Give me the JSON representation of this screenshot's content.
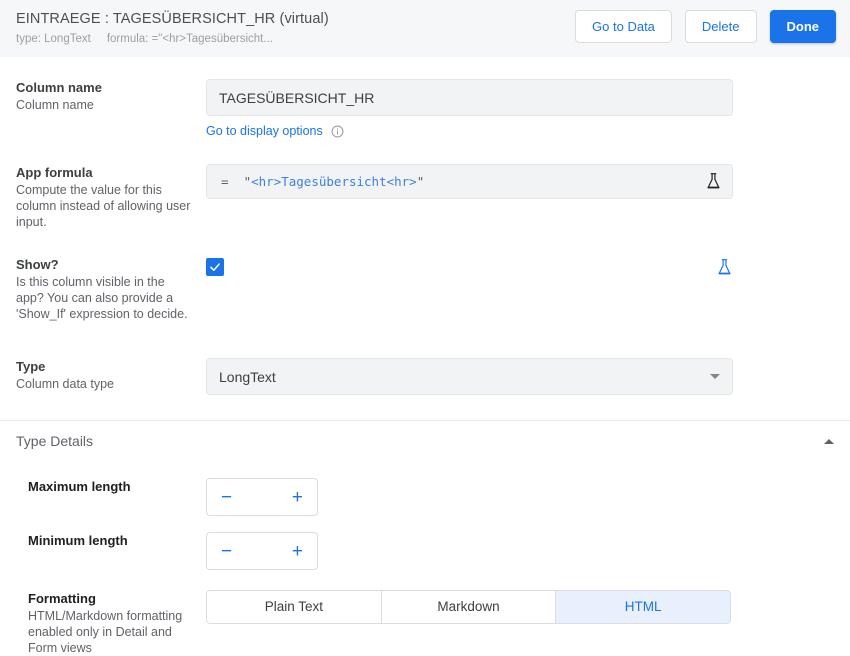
{
  "header": {
    "title": "EINTRAEGE : TAGESÜBERSICHT_HR (virtual)",
    "type_label": "type: LongText",
    "formula_label": "formula:",
    "formula_preview": "=\"<hr>Tagesübersicht...",
    "buttons": {
      "go_to_data": "Go to Data",
      "delete": "Delete",
      "done": "Done"
    }
  },
  "column_name": {
    "title": "Column name",
    "desc": "Column name",
    "value": "TAGESÜBERSICHT_HR",
    "display_options_link": "Go to display options",
    "info_icon": "info-icon"
  },
  "app_formula": {
    "title": "App formula",
    "desc": "Compute the value for this column instead of allowing user input.",
    "equals": "=",
    "open_quote": "\"",
    "tag_open": "<hr>",
    "word": "Tagesübersicht",
    "tag_close": "<hr>",
    "close_quote": "\"",
    "flask_icon": "flask-icon"
  },
  "show": {
    "title": "Show?",
    "desc": "Is this column visible in the app? You can also provide a 'Show_If' expression to decide.",
    "checked": true,
    "flask_icon": "flask-icon"
  },
  "type": {
    "title": "Type",
    "desc": "Column data type",
    "value": "LongText"
  },
  "type_details": {
    "title": "Type Details",
    "collapse_icon": "chevron-up-icon",
    "maximum_length": {
      "title": "Maximum length",
      "desc": "",
      "value": "",
      "minus": "−",
      "plus": "+"
    },
    "minimum_length": {
      "title": "Minimum length",
      "desc": "",
      "value": "",
      "minus": "−",
      "plus": "+"
    },
    "formatting": {
      "title": "Formatting",
      "desc": "HTML/Markdown formatting enabled only in Detail and Form views",
      "options": [
        "Plain Text",
        "Markdown",
        "HTML"
      ],
      "selected": "HTML"
    }
  },
  "colors": {
    "accent": "#1a73e8",
    "accent_light": "#e8f0fe",
    "field_bg": "#f1f3f4",
    "header_bg": "#f6f7f9"
  }
}
